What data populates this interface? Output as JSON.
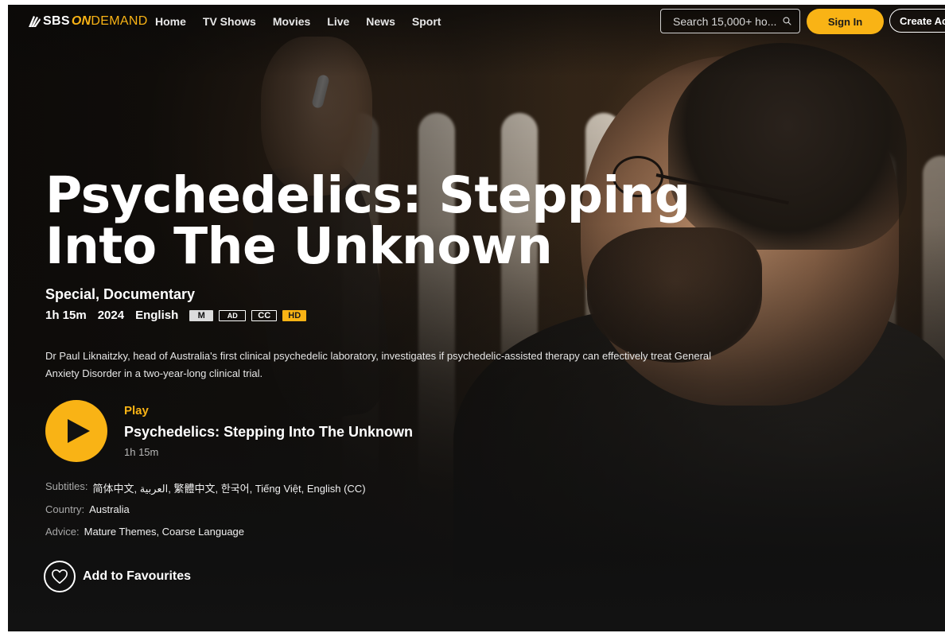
{
  "header": {
    "logo": {
      "sbs": "SBS",
      "on": "ON",
      "demand": "DEMAND"
    },
    "nav": [
      "Home",
      "TV Shows",
      "Movies",
      "Live",
      "News",
      "Sport"
    ],
    "search_placeholder": "Search 15,000+ ho...",
    "sign_in_label": "Sign In",
    "create_account_label": "Create Ac"
  },
  "program": {
    "title": "Psychedelics: Stepping Into The Unknown",
    "genres": "Special, Documentary",
    "duration": "1h 15m",
    "year": "2024",
    "language": "English",
    "badges": {
      "rating": "M",
      "audio_description": "AD",
      "captions": "CC",
      "quality": "HD"
    },
    "description": "Dr Paul Liknaitzky, head of Australia's first clinical psychedelic laboratory, investigates if psychedelic-assisted therapy can effectively treat General Anxiety Disorder in a two-year-long clinical trial."
  },
  "player": {
    "play_label": "Play",
    "episode_title": "Psychedelics: Stepping Into The Unknown",
    "episode_duration": "1h 15m"
  },
  "details": {
    "subtitles_label": "Subtitles:",
    "subtitles_value": "简体中文, العربية, 繁體中文, 한국어, Tiếng Việt, English (CC)",
    "country_label": "Country:",
    "country_value": "Australia",
    "advice_label": "Advice:",
    "advice_value": "Mature Themes, Coarse Language"
  },
  "favourites": {
    "label": "Add to Favourites"
  },
  "colors": {
    "accent": "#f9b315",
    "background": "#121212"
  },
  "icons": [
    "sbs-fan-icon",
    "search-icon",
    "play-icon",
    "heart-icon"
  ]
}
